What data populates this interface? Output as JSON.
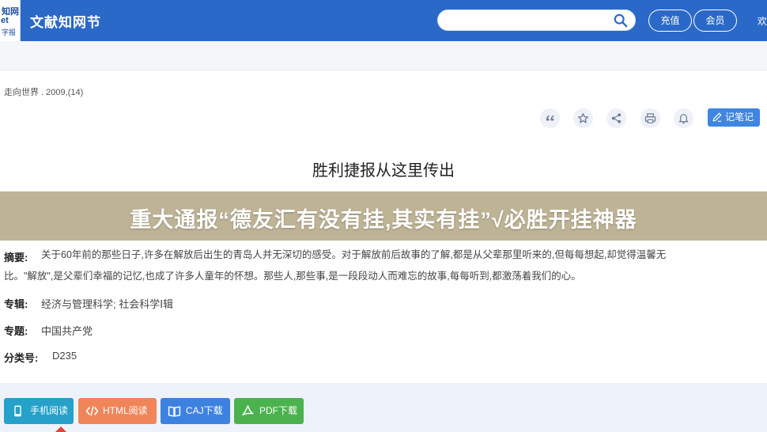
{
  "header": {
    "logo_lines": [
      "知网",
      "et",
      "字报"
    ],
    "brand": "文献知网节",
    "search_placeholder": "",
    "recharge_label": "充值",
    "member_label": "会员",
    "welcome": "欢迎"
  },
  "source": "走向世界 . 2009,(14)",
  "toolbar": {
    "icons": [
      "quote-icon",
      "star-icon",
      "share-icon",
      "print-icon",
      "bell-icon"
    ],
    "note_label": "记笔记"
  },
  "article": {
    "title": "胜利捷报从这里传出"
  },
  "banner": {
    "text": "重大通报“德友汇有没有挂,其实有挂”√必胜开挂神器"
  },
  "abstract": {
    "label": "摘要:",
    "line1": "关于60年前的那些日子,许多在解放后出生的青岛人并无深切的感受。对于解放前后故事的了解,都是从父辈那里听来的,但每每想起,却觉得温馨无",
    "line2": "比。\"解放\",是父辈们幸福的记忆,也成了许多人童年的怀想。那些人,那些事,是一段段动人而难忘的故事,每每听到,都激荡着我们的心。"
  },
  "meta": {
    "series_label": "专辑:",
    "series_value": "经济与管理科学; 社会科学Ⅰ辑",
    "topic_label": "专题:",
    "topic_value": "中国共产党",
    "class_label": "分类号:",
    "class_value": "D235"
  },
  "actions": {
    "phone": "手机阅读",
    "html": "HTML阅读",
    "caj": "CAJ下载",
    "pdf": "PDF下载"
  },
  "colors": {
    "header_bg": "#2b69c9",
    "banner_bg": "#bfb396",
    "phone_btn": "#26a1c9",
    "html_btn": "#f0855a",
    "caj_btn": "#3d82e0",
    "pdf_btn": "#4bb34d"
  }
}
